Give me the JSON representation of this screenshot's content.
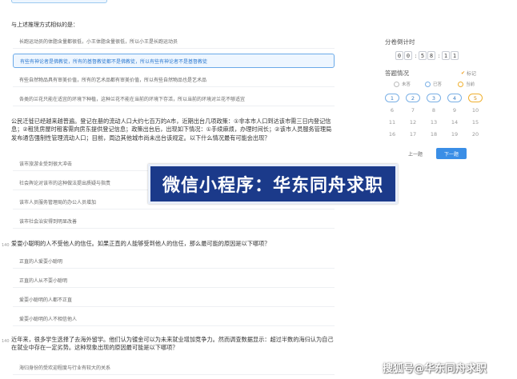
{
  "question_prev": {
    "title": "与上述推理方式相似的是：",
    "options": [
      "长跑运动员的体脂含量都很低，小王体脂含量很低，所以小王是长跑运动员",
      "有些有神论者是佛教徒，所有的基督教徒都不是佛教徒，所以有些有神论者不是基督教徒",
      "有些自然物品具有审美价值，所有的艺术品都有审美价值，所以有些自然物品也是艺术品",
      "各类的兰花只能在适宜的环境下种植，这种兰花不能在当前的环境下存活，所以当前的环境对兰花不够适宜"
    ],
    "selected_index": 1
  },
  "question_a": {
    "text": "公民迁徙已经越来越普遍。登记在册的流动人口大约七百万的A市，近期出台几项政策：①非本市人口到达该市需三日内登记信息；②租赁房屋时租客需向房东提供登记信息；政策出台后，出现如下情况：①手续麻烦，办理时间长；②该市人员服务管理局发布通告强制性管理流动人口；目前，周边其他城市尚未出台该规定。以下什么情况最有可能会出现？",
    "options": [
      "该市旅游业受到很大冲击",
      "社会舆论对该市的这种做法提出质疑与指责",
      "该市人员服务管理局的办公人员增加",
      "该市社会治安得到明显改善"
    ]
  },
  "question_b": {
    "number": "140",
    "text": "爱耍小聪明的人不受他人的信任。如果正直的人能够受到他人的信任，那么最可能的原因是以下哪项？",
    "options": [
      "正直的人爱耍小聪明",
      "正直的人从不耍小聪明",
      "爱耍小聪明的人都不正直",
      "爱耍小聪明的人不相信他人"
    ]
  },
  "question_c": {
    "number": "140",
    "text": "近年来，很多学生选择了去海外留学。他们认为镀金可以为未来就业增加竞争力。然而调查数据显示：超过半数的海归认为自己在就业中存在一定劣势。这种现象出现的原因最可能是以下哪项？",
    "options": [
      "海归身份的受欢迎程度与行业有较大的关系"
    ]
  },
  "right_panel": {
    "timer_title": "分卷倒计时",
    "timer_digits": [
      "0",
      "0",
      "5",
      "8",
      "1",
      "1"
    ],
    "timer_sep": ":",
    "status_title": "答题情况",
    "flag_label": "标记",
    "legend": [
      "未答",
      "已答",
      "当前"
    ],
    "numbers": [
      "1",
      "2",
      "3",
      "4",
      "5",
      "6",
      "7",
      "8",
      "9",
      "10",
      "11",
      "12",
      "13",
      "14",
      "15",
      "16",
      "17",
      "18",
      "19",
      "20"
    ],
    "done_indices": [
      0,
      1,
      2,
      3
    ],
    "marked_indices": [
      4
    ],
    "prev_label": "上一题",
    "next_label": "下一题",
    "accent": "#3a8ee6",
    "mark_color": "#f0b030"
  },
  "banner": {
    "text": "微信小程序：华东同舟求职",
    "bg_color": "#1b3a8a"
  },
  "watermark": {
    "text": "搜狐号@华东同舟求职"
  }
}
